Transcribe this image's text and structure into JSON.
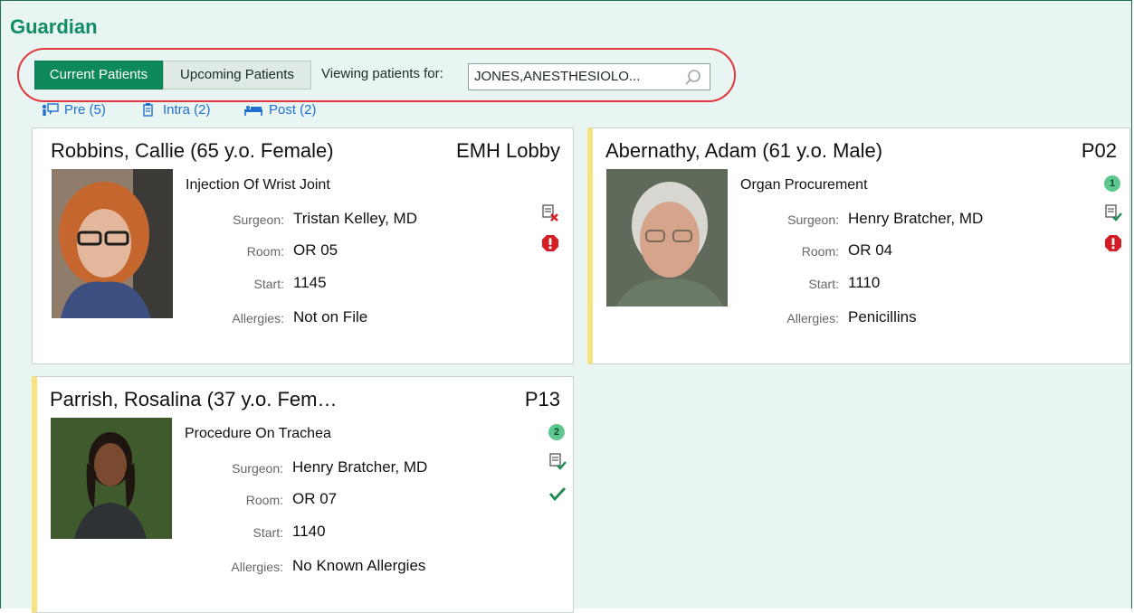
{
  "app": {
    "title": "Guardian"
  },
  "tabs": {
    "current": "Current Patients",
    "upcoming": "Upcoming Patients"
  },
  "filter": {
    "label": "Viewing patients for:",
    "value": "JONES,ANESTHESIOLO..."
  },
  "phases": [
    {
      "label": "Pre (5)",
      "icon": "pre-op-icon"
    },
    {
      "label": "Intra (2)",
      "icon": "intra-op-icon"
    },
    {
      "label": "Post (2)",
      "icon": "post-op-icon"
    }
  ],
  "field_labels": {
    "surgeon": "Surgeon:",
    "room": "Room:",
    "start": "Start:",
    "allergies": "Allergies:"
  },
  "patients": [
    {
      "name": "Robbins, Callie (65 y.o. Female)",
      "location": "EMH Lobby",
      "procedure": "Injection Of Wrist Joint",
      "surgeon": "Tristan Kelley, MD",
      "room": "OR 05",
      "start": "1145",
      "allergies": "Not on File",
      "status_icons": [
        "note-rejected-icon",
        "alert-icon"
      ]
    },
    {
      "name": "Abernathy, Adam (61 y.o. Male)",
      "location": "P02",
      "procedure": "Organ Procurement",
      "surgeon": "Henry Bratcher, MD",
      "room": "OR 04",
      "start": "1110",
      "allergies": "Penicillins",
      "badge": "1",
      "status_icons": [
        "note-approved-icon",
        "alert-icon"
      ]
    },
    {
      "name": "Parrish, Rosalina (37 y.o. Fem…",
      "location": "P13",
      "procedure": "Procedure On Trachea",
      "surgeon": "Henry Bratcher, MD",
      "room": "OR 07",
      "start": "1140",
      "allergies": "No Known Allergies",
      "badge": "2",
      "status_icons": [
        "note-approved-icon",
        "checkmark-icon"
      ]
    }
  ],
  "colors": {
    "brand": "#0f8c61",
    "accent_tab": "#0e8a5a",
    "link": "#1f6fd1",
    "alert": "#d41c24",
    "flag": "#f7e27e"
  }
}
